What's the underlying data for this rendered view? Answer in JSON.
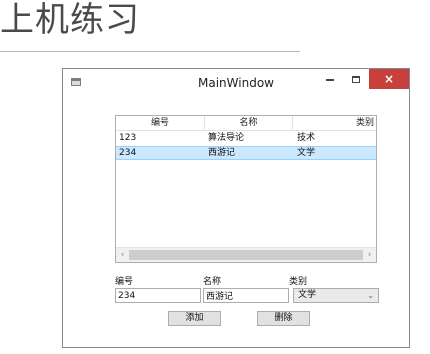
{
  "page": {
    "heading": "上机练习"
  },
  "window": {
    "title": "MainWindow",
    "close_glyph": "×"
  },
  "list": {
    "columns": [
      "编号",
      "名称",
      "类别"
    ],
    "rows": [
      {
        "id": "123",
        "name": "算法导论",
        "category": "技术",
        "selected": false
      },
      {
        "id": "234",
        "name": "西游记",
        "category": "文学",
        "selected": true
      }
    ],
    "scroll_left": "‹",
    "scroll_right": "›"
  },
  "form": {
    "id_label": "编号",
    "name_label": "名称",
    "category_label": "类别",
    "id_value": "234",
    "name_value": "西游记",
    "category_value": "文学",
    "combo_arrow": "⌄"
  },
  "buttons": {
    "add": "添加",
    "delete": "删除"
  },
  "colors": {
    "selection": "#cce8ff",
    "close_button": "#c7403a"
  }
}
